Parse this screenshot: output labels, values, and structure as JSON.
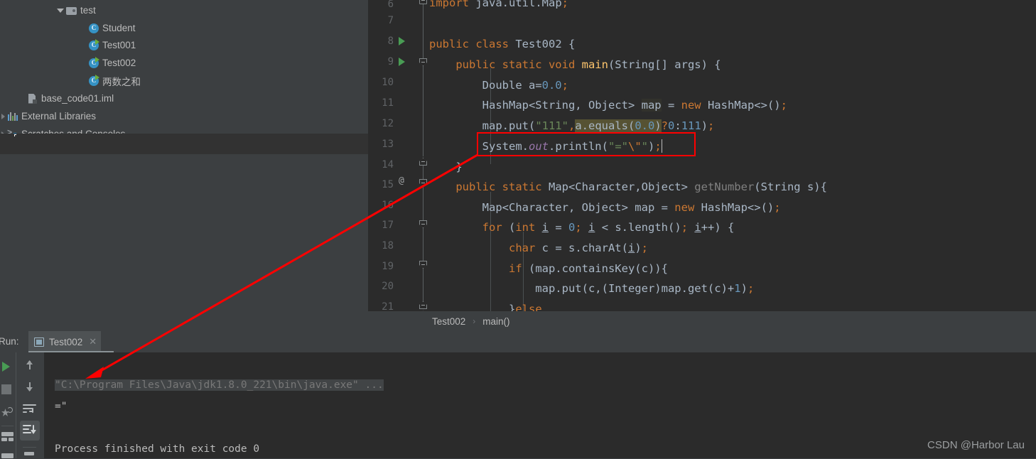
{
  "app": {
    "theme_bg": "#3c3f41",
    "editor_bg": "#2b2b2b",
    "accent_red": "#ff0000"
  },
  "sidebar": {
    "name": "project-tree",
    "items": [
      {
        "label": "test",
        "icon": "folder-icon",
        "indent": 0,
        "expanded": true,
        "twisty": "down"
      },
      {
        "label": "Student",
        "icon": "java-class-icon",
        "indent": 1,
        "runnable": false
      },
      {
        "label": "Test001",
        "icon": "java-class-icon",
        "indent": 1,
        "runnable": true
      },
      {
        "label": "Test002",
        "icon": "java-class-icon",
        "indent": 1,
        "runnable": true
      },
      {
        "label": "两数之和",
        "icon": "java-class-icon",
        "indent": 1,
        "runnable": true
      },
      {
        "label": "base_code01.iml",
        "icon": "iml-file-icon",
        "indent": 0
      },
      {
        "label": "External Libraries",
        "icon": "libraries-icon",
        "indent": -1,
        "twisty": "right"
      },
      {
        "label": "Scratches and Consoles",
        "icon": "scratches-icon",
        "indent": -1,
        "twisty": "right"
      }
    ]
  },
  "editor": {
    "name": "code-editor",
    "file": "Test002.java",
    "lines": [
      {
        "n": "6",
        "text": "import java.util.Map;"
      },
      {
        "n": "7",
        "text": ""
      },
      {
        "n": "8",
        "text": "public class Test002 {"
      },
      {
        "n": "9",
        "text": "    public static void main(String[] args) {"
      },
      {
        "n": "10",
        "text": "        Double a=0.0;"
      },
      {
        "n": "11",
        "text": "        HashMap<String, Object> map = new HashMap<>();"
      },
      {
        "n": "12",
        "text": "        map.put(\"111\",a.equals(0.0)?0:111);"
      },
      {
        "n": "13",
        "text": "        System.out.println(\"=\\\"\");"
      },
      {
        "n": "14",
        "text": "    }"
      },
      {
        "n": "15",
        "text": "    public static Map<Character,Object> getNumber(String s){"
      },
      {
        "n": "16",
        "text": "        Map<Character, Object> map = new HashMap<>();"
      },
      {
        "n": "17",
        "text": "        for (int i = 0; i < s.length(); i++) {"
      },
      {
        "n": "18",
        "text": "            char c = s.charAt(i);"
      },
      {
        "n": "19",
        "text": "            if (map.containsKey(c)){"
      },
      {
        "n": "20",
        "text": "                map.put(c,(Integer)map.get(c)+1);"
      },
      {
        "n": "21",
        "text": "            }else"
      }
    ],
    "caret_line": "13",
    "annotation_marker": "@",
    "annotation_line": "15"
  },
  "breadcrumb": {
    "name": "editor-breadcrumb",
    "class_crumb": "Test002",
    "separator": "›",
    "method_crumb": "main()"
  },
  "run_panel": {
    "name": "run-tool-window",
    "title": "Run:",
    "tab_label": "Test002",
    "close_label": "✕",
    "toolbar": [
      {
        "name": "rerun-button",
        "icon": "play-icon"
      },
      {
        "name": "stop-button",
        "icon": "stop-icon"
      },
      {
        "name": "rerun-failed-icon",
        "icon": "rerun-failed-icon"
      },
      {
        "name": "layout-button",
        "icon": "layout-icon"
      },
      {
        "name": "scroll-up-button",
        "icon": "arrow-up-icon"
      },
      {
        "name": "scroll-down-button",
        "icon": "arrow-down-icon"
      },
      {
        "name": "soft-wrap-button",
        "icon": "soft-wrap-icon"
      },
      {
        "name": "scroll-to-end-button",
        "icon": "scroll-to-end-icon"
      },
      {
        "name": "print-button",
        "icon": "print-icon"
      }
    ],
    "console_lines": [
      {
        "text": "\"C:\\Program Files\\Java\\jdk1.8.0_221\\bin\\java.exe\" ...",
        "kind": "command"
      },
      {
        "text": "=\"",
        "kind": "output"
      },
      {
        "text": "",
        "kind": "output"
      },
      {
        "text": "Process finished with exit code 0",
        "kind": "output"
      }
    ]
  },
  "watermark": {
    "name": "csdn-watermark",
    "text": "CSDN @Harbor Lau"
  }
}
